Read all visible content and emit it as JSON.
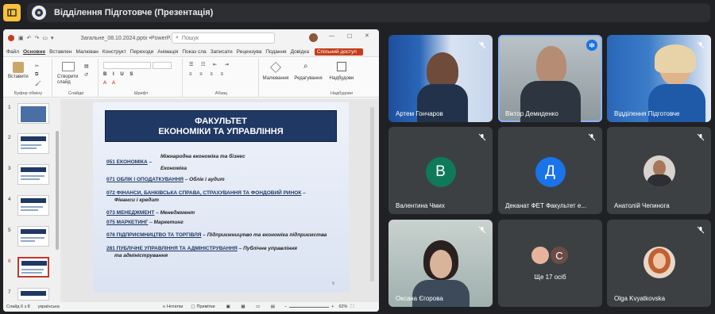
{
  "window": {
    "title": "Відділення Підготовче (Презентація)"
  },
  "ppt": {
    "filename": "Загальне_08.10.2024.pptx",
    "app": "PowerP...",
    "search_placeholder": "Пошук",
    "tabs": [
      "Файл",
      "Основне",
      "Вставлен",
      "Малюван",
      "Конструкт",
      "Переходи",
      "Анімація",
      "Показ сла",
      "Записати",
      "Рецензува",
      "Подання",
      "Довідка"
    ],
    "share_label": "Спільний доступ",
    "ribbon_groups": {
      "clipboard": "Буфер обміну",
      "paste": "Вставити",
      "slides": "Слайди",
      "new_slide": "Створити слайд",
      "font": "Шрифт",
      "paragraph": "Абзац",
      "drawing": "Малювання",
      "editing": "Редагування",
      "addins": "Надбудови",
      "addins_group": "Надбудови"
    },
    "thumb_numbers": [
      "1",
      "2",
      "3",
      "4",
      "5",
      "6",
      "7"
    ],
    "slide": {
      "title_line1": "ФАКУЛЬТЕТ",
      "title_line2": "ЕКОНОМІКИ ТА УПРАВЛІННЯ",
      "items": [
        {
          "code": "051 ЕКОНОМІКА",
          "dash": " –",
          "desc": "Міжнародна економіка та бізнес"
        },
        {
          "code": "",
          "dash": "",
          "desc": "Економіка"
        },
        {
          "code": "071 ОБЛІК І ОПОДАТКУВАННЯ",
          "dash": " – ",
          "desc": "Облік і аудит"
        },
        {
          "code": "072 ФІНАНСИ, БАНКІВСЬКА СПРАВА, СТРАХУВАННЯ ТА ФОНДОВИЙ РИНОК",
          "dash": " –",
          "desc": ""
        },
        {
          "code": "",
          "dash": "",
          "desc": "Фінанси і кредит"
        },
        {
          "code": "073 МЕНЕДЖМЕНТ",
          "dash": " – ",
          "desc": "Менеджмент"
        },
        {
          "code": "075 МАРКЕТИНГ",
          "dash": " – ",
          "desc": "Маркетинг"
        },
        {
          "code": "076 ПІДПРИЄМНИЦТВО ТА ТОРГІВЛЯ",
          "dash": " – ",
          "desc": "Підприємництво та економіка підприємства"
        },
        {
          "code": "281 ПУБЛІЧНЕ УПРАВЛІННЯ ТА АДМІНІСТРУВАННЯ",
          "dash": " – ",
          "desc": "Публічне управління"
        },
        {
          "code": "",
          "dash": "",
          "desc": "та адміністрування"
        }
      ],
      "slide_no": "6"
    },
    "status": {
      "slide_of": "Слайд 6 з 8",
      "language": "українська",
      "notes": "Нотатки",
      "comments": "Примітки",
      "zoom": "62%"
    }
  },
  "participants": [
    {
      "name": "Артем Гончаров",
      "type": "video"
    },
    {
      "name": "Віктор Демиденко",
      "type": "video"
    },
    {
      "name": "Відділення Підготовче",
      "type": "video"
    },
    {
      "name": "Валентина Чмих",
      "type": "letter",
      "letter": "В",
      "color": "#0f7a5a"
    },
    {
      "name": "Деканат ФЕТ Факультет е...",
      "type": "letter",
      "letter": "Д",
      "color": "#1a73e8"
    },
    {
      "name": "Анатолій Чепинога",
      "type": "photo"
    },
    {
      "name": "Оксана Єгорова",
      "type": "video"
    },
    {
      "name": "Ще 17 осіб",
      "type": "more",
      "letter": "С"
    },
    {
      "name": "Olga Kvyatkovska",
      "type": "photo"
    }
  ]
}
